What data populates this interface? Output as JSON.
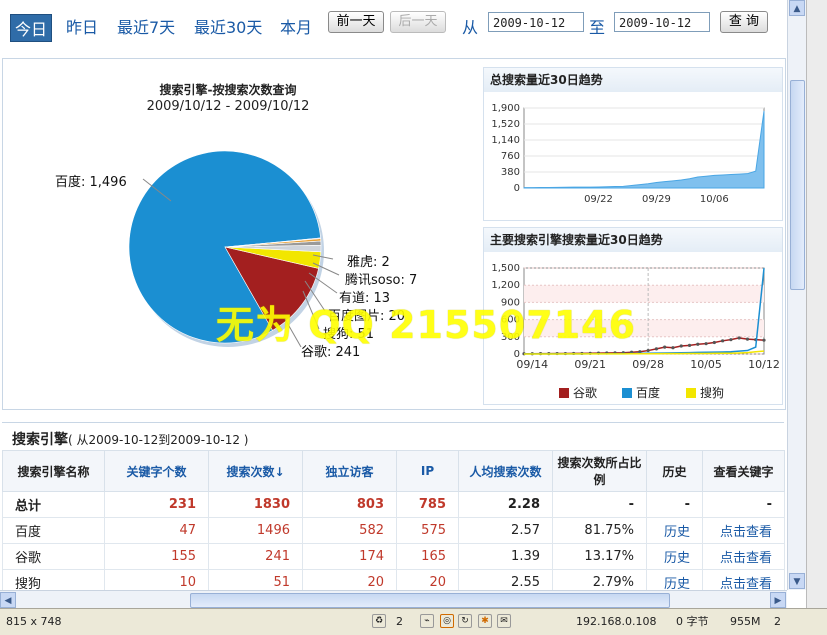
{
  "nav": {
    "periods": [
      "今日",
      "昨日",
      "最近7天",
      "最近30天",
      "本月"
    ],
    "prev_day": "前一天",
    "next_day": "后一天",
    "from_label": "从",
    "to_label": "至",
    "start_date": "2009-10-12",
    "end_date": "2009-10-12",
    "query": "查 询"
  },
  "pie": {
    "title": "搜索引擎-按搜索次数查询",
    "subtitle": "2009/10/12 - 2009/10/12",
    "labels": [
      "百度: 1,496",
      "雅虎: 2",
      "腾讯soso: 7",
      "有道: 13",
      "百度图片: 20",
      "搜狗: 51",
      "谷歌: 241"
    ]
  },
  "trend": {
    "title": "总搜索量近30日趋势",
    "yticks": [
      "1,900",
      "1,520",
      "1,140",
      "760",
      "380",
      "0"
    ],
    "xticks": [
      "09/22",
      "09/29",
      "10/06"
    ]
  },
  "engine_trend": {
    "title": "主要搜索引擎搜索量近30日趋势",
    "yticks": [
      "1,500",
      "1,200",
      "900",
      "600",
      "300",
      "0"
    ],
    "xticks": [
      "09/14",
      "09/21",
      "09/28",
      "10/05",
      "10/12"
    ],
    "legend": [
      "谷歌",
      "百度",
      "搜狗"
    ]
  },
  "watermark": "无为 QQ 215507146",
  "section": {
    "title": "搜索引擎",
    "range": "( 从2009-10-12到2009-10-12 )"
  },
  "table": {
    "headers": [
      "搜索引擎名称",
      "关键字个数",
      "搜索次数↓",
      "独立访客",
      "IP",
      "人均搜索次数",
      "搜索次数所占比例",
      "历史",
      "查看关键字"
    ],
    "rows": [
      [
        "总计",
        "231",
        "1830",
        "803",
        "785",
        "2.28",
        "-",
        "-",
        "-"
      ],
      [
        "百度",
        "47",
        "1496",
        "582",
        "575",
        "2.57",
        "81.75%",
        "历史",
        "点击查看"
      ],
      [
        "谷歌",
        "155",
        "241",
        "174",
        "165",
        "1.39",
        "13.17%",
        "历史",
        "点击查看"
      ],
      [
        "搜狗",
        "10",
        "51",
        "20",
        "20",
        "2.55",
        "2.79%",
        "历史",
        "点击查看"
      ]
    ]
  },
  "status": {
    "size": "815 x 748",
    "count": "2",
    "ip": "192.168.0.108",
    "bytes": "0 字节",
    "mem": "955M",
    "num": "2"
  },
  "colors": {
    "google": "#a31f1f",
    "baidu": "#1b8fd2",
    "sogou": "#f2e600",
    "accent": "#1a5aa6"
  },
  "chart_data": [
    {
      "type": "pie",
      "title": "搜索引擎-按搜索次数查询",
      "subtitle": "2009/10/12 - 2009/10/12",
      "categories": [
        "百度",
        "谷歌",
        "搜狗",
        "百度图片",
        "有道",
        "腾讯soso",
        "雅虎"
      ],
      "values": [
        1496,
        241,
        51,
        20,
        13,
        7,
        2
      ]
    },
    {
      "type": "area",
      "title": "总搜索量近30日趋势",
      "ylim": [
        0,
        1900
      ],
      "x": [
        "09/13",
        "09/14",
        "09/15",
        "09/16",
        "09/17",
        "09/18",
        "09/19",
        "09/20",
        "09/21",
        "09/22",
        "09/23",
        "09/24",
        "09/25",
        "09/26",
        "09/27",
        "09/28",
        "09/29",
        "09/30",
        "10/01",
        "10/02",
        "10/03",
        "10/04",
        "10/05",
        "10/06",
        "10/07",
        "10/08",
        "10/09",
        "10/10",
        "10/11",
        "10/12"
      ],
      "values": [
        10,
        10,
        12,
        12,
        15,
        18,
        20,
        20,
        22,
        25,
        30,
        35,
        40,
        60,
        80,
        100,
        130,
        150,
        170,
        190,
        220,
        260,
        280,
        300,
        310,
        320,
        330,
        340,
        400,
        1830
      ]
    },
    {
      "type": "line",
      "title": "主要搜索引擎搜索量近30日趋势",
      "ylim": [
        0,
        1500
      ],
      "x": [
        "09/13",
        "09/14",
        "09/15",
        "09/16",
        "09/17",
        "09/18",
        "09/19",
        "09/20",
        "09/21",
        "09/22",
        "09/23",
        "09/24",
        "09/25",
        "09/26",
        "09/27",
        "09/28",
        "09/29",
        "09/30",
        "10/01",
        "10/02",
        "10/03",
        "10/04",
        "10/05",
        "10/06",
        "10/07",
        "10/08",
        "10/09",
        "10/10",
        "10/11",
        "10/12"
      ],
      "series": [
        {
          "name": "谷歌",
          "values": [
            5,
            5,
            6,
            6,
            8,
            8,
            10,
            10,
            12,
            15,
            18,
            20,
            22,
            30,
            40,
            60,
            90,
            120,
            110,
            140,
            150,
            170,
            180,
            200,
            230,
            250,
            280,
            260,
            250,
            241
          ]
        },
        {
          "name": "百度",
          "values": [
            2,
            2,
            2,
            2,
            3,
            3,
            3,
            3,
            4,
            4,
            5,
            5,
            6,
            8,
            10,
            12,
            15,
            18,
            20,
            22,
            25,
            28,
            30,
            32,
            35,
            40,
            50,
            60,
            120,
            1496
          ]
        },
        {
          "name": "搜狗",
          "values": [
            1,
            1,
            1,
            1,
            1,
            2,
            2,
            2,
            2,
            2,
            3,
            3,
            3,
            4,
            4,
            5,
            5,
            6,
            6,
            7,
            8,
            8,
            9,
            10,
            12,
            14,
            18,
            25,
            40,
            51
          ]
        }
      ]
    }
  ]
}
